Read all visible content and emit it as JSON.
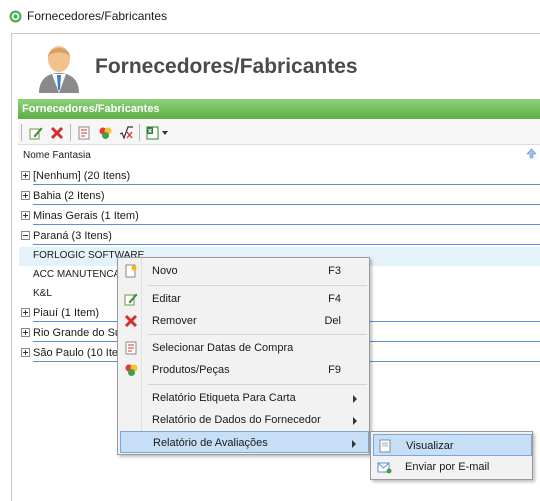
{
  "window": {
    "title": "Fornecedores/Fabricantes"
  },
  "header": {
    "title": "Fornecedores/Fabricantes"
  },
  "panel": {
    "title": "Fornecedores/Fabricantes"
  },
  "toolbar": {
    "icons": [
      "new-icon",
      "delete-icon",
      "dates-icon",
      "products-icon",
      "formula-icon",
      "excel-export-icon"
    ]
  },
  "grid": {
    "column_header": "Nome Fantasia",
    "groups": [
      {
        "label": "[Nenhum] (20 Itens)",
        "expanded": false
      },
      {
        "label": "Bahia (2 Itens)",
        "expanded": false
      },
      {
        "label": "Minas Gerais (1 Item)",
        "expanded": false
      },
      {
        "label": "Paraná (3 Itens)",
        "expanded": true
      },
      {
        "label": "Piauí (1 Item)",
        "expanded": false
      },
      {
        "label": "Rio Grande do Sul",
        "expanded": false
      },
      {
        "label": "São Paulo (10 Iten",
        "expanded": false
      }
    ],
    "rows": [
      {
        "label": "FORLOGIC SOFTWARE"
      },
      {
        "label": "ACC MANUTENCA"
      },
      {
        "label": "K&L"
      }
    ]
  },
  "context_menu": {
    "items": [
      {
        "label": "Novo",
        "shortcut": "F3",
        "icon": "new-icon"
      },
      {
        "label": "Editar",
        "shortcut": "F4",
        "icon": "edit-icon"
      },
      {
        "label": "Remover",
        "shortcut": "Del",
        "icon": "remove-icon"
      },
      {
        "label": "Selecionar Datas de Compra",
        "shortcut": "",
        "icon": "calendar-icon"
      },
      {
        "label": "Produtos/Peças",
        "shortcut": "F9",
        "icon": "products-icon"
      },
      {
        "label": "Relatório Etiqueta Para Carta",
        "shortcut": "",
        "icon": ""
      },
      {
        "label": "Relatório de Dados do Fornecedor",
        "shortcut": "",
        "icon": ""
      },
      {
        "label": "Relatório de Avaliações",
        "shortcut": "",
        "icon": ""
      }
    ]
  },
  "submenu": {
    "items": [
      {
        "label": "Visualizar",
        "icon": "preview-icon"
      },
      {
        "label": "Enviar por E-mail",
        "icon": "email-icon"
      }
    ]
  },
  "colors": {
    "panel_green": "#5caf45",
    "group_line": "#5b8fd6",
    "highlight": "#c7def7"
  }
}
